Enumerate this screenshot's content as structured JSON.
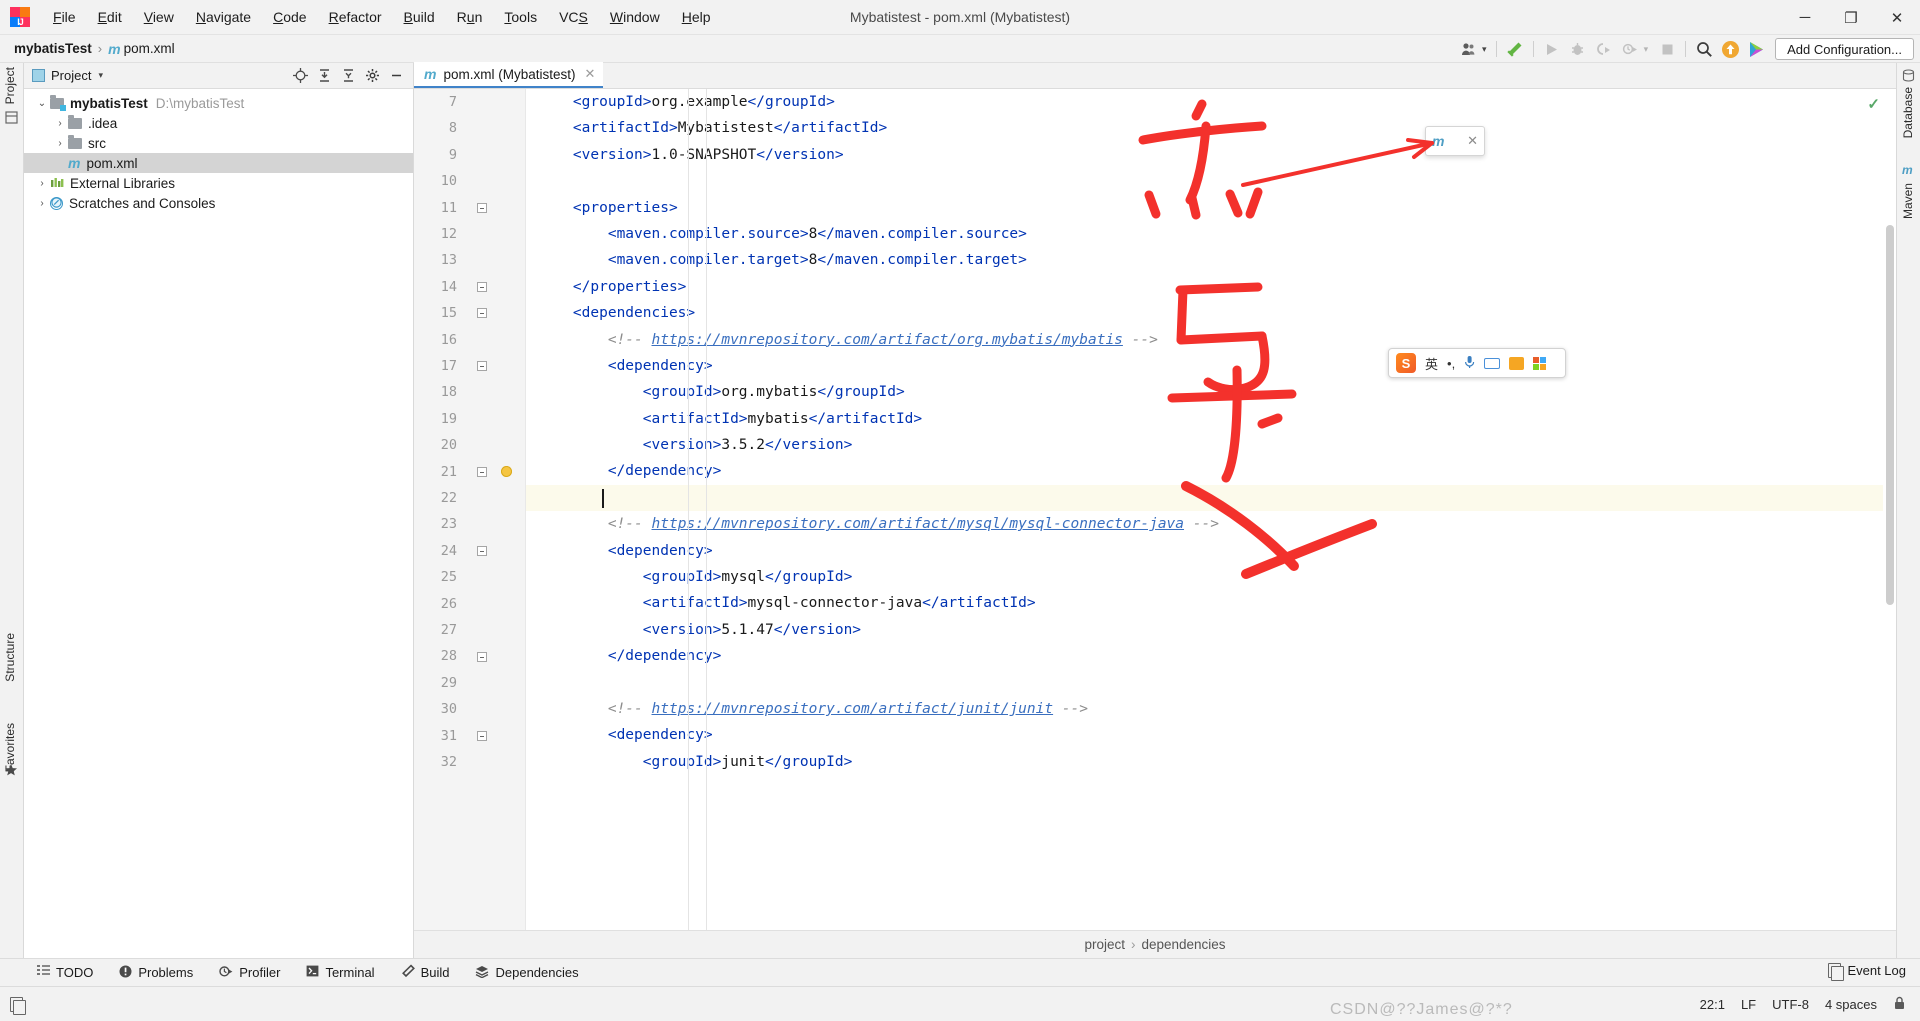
{
  "titlebar": {
    "app_icon": "intellij-logo-icon",
    "window_title": "Mybatistest - pom.xml (Mybatistest)",
    "menus": [
      {
        "label": "File"
      },
      {
        "label": "Edit"
      },
      {
        "label": "View"
      },
      {
        "label": "Navigate"
      },
      {
        "label": "Code"
      },
      {
        "label": "Refactor"
      },
      {
        "label": "Build"
      },
      {
        "label": "Run"
      },
      {
        "label": "Tools"
      },
      {
        "label": "VCS"
      },
      {
        "label": "Window"
      },
      {
        "label": "Help"
      }
    ],
    "controls": {
      "minimize": "─",
      "maximize": "❐",
      "close": "✕"
    }
  },
  "navbar": {
    "breadcrumb": {
      "project": "mybatisTest",
      "separator": "›",
      "file": "pom.xml",
      "file_icon_glyph": "m"
    },
    "add_configuration": "Add Configuration...",
    "icons": [
      "user-settings-icon",
      "build-hammer-icon",
      "run-icon",
      "debug-icon",
      "run-with-coverage-icon",
      "profile-icon",
      "stop-icon",
      "search-icon",
      "updates-icon",
      "ide-features-icon"
    ]
  },
  "left_strip": {
    "top_label": "Project",
    "bottom_labels": [
      "Structure",
      "Favorites"
    ],
    "bookmark_icon": "star-icon"
  },
  "right_strip": {
    "labels": [
      "Database",
      "Maven"
    ]
  },
  "project_panel": {
    "title": "Project",
    "dropdown_glyph": "▾",
    "actions": [
      "locate-icon",
      "expand-all-icon",
      "collapse-all-icon",
      "settings-gear-icon",
      "hide-icon"
    ],
    "tree": [
      {
        "label": "mybatisTest",
        "path": "D:\\mybatisTest",
        "icon": "module-folder-icon",
        "arrow": "⌄",
        "depth": 0,
        "bold": true,
        "selected": false
      },
      {
        "label": ".idea",
        "path": "",
        "icon": "folder-icon",
        "arrow": "›",
        "depth": 1,
        "bold": false,
        "selected": false
      },
      {
        "label": "src",
        "path": "",
        "icon": "folder-icon",
        "arrow": "›",
        "depth": 1,
        "bold": false,
        "selected": false
      },
      {
        "label": "pom.xml",
        "path": "",
        "icon": "maven-file-icon",
        "arrow": "",
        "depth": 1,
        "bold": false,
        "selected": true
      },
      {
        "label": "External Libraries",
        "path": "",
        "icon": "libraries-icon",
        "arrow": "›",
        "depth": 0,
        "bold": false,
        "selected": false
      },
      {
        "label": "Scratches and Consoles",
        "path": "",
        "icon": "scratches-icon",
        "arrow": "›",
        "depth": 0,
        "bold": false,
        "selected": false
      }
    ]
  },
  "editor": {
    "tab": {
      "label": "pom.xml (Mybatistest)",
      "icon_glyph": "m",
      "close_glyph": "✕"
    },
    "inspection_status": "✓",
    "first_line_number": 7,
    "current_line": 22,
    "lines": [
      {
        "n": 7,
        "indent": 2,
        "fold": "",
        "bulb": false,
        "segments": [
          {
            "t": "tag",
            "v": "<groupId>"
          },
          {
            "t": "text",
            "v": "org.example"
          },
          {
            "t": "tag",
            "v": "</groupId>"
          }
        ]
      },
      {
        "n": 8,
        "indent": 2,
        "fold": "",
        "bulb": false,
        "segments": [
          {
            "t": "tag",
            "v": "<artifactId>"
          },
          {
            "t": "text",
            "v": "Mybatistest"
          },
          {
            "t": "tag",
            "v": "</artifactId>"
          }
        ]
      },
      {
        "n": 9,
        "indent": 2,
        "fold": "",
        "bulb": false,
        "segments": [
          {
            "t": "tag",
            "v": "<version>"
          },
          {
            "t": "text",
            "v": "1.0-SNAPSHOT"
          },
          {
            "t": "tag",
            "v": "</version>"
          }
        ]
      },
      {
        "n": 10,
        "indent": 0,
        "fold": "",
        "bulb": false,
        "segments": []
      },
      {
        "n": 11,
        "indent": 2,
        "fold": "start",
        "bulb": false,
        "segments": [
          {
            "t": "tag",
            "v": "<properties>"
          }
        ]
      },
      {
        "n": 12,
        "indent": 4,
        "fold": "",
        "bulb": false,
        "segments": [
          {
            "t": "tag",
            "v": "<maven.compiler.source>"
          },
          {
            "t": "text",
            "v": "8"
          },
          {
            "t": "tag",
            "v": "</maven.compiler.source>"
          }
        ]
      },
      {
        "n": 13,
        "indent": 4,
        "fold": "",
        "bulb": false,
        "segments": [
          {
            "t": "tag",
            "v": "<maven.compiler.target>"
          },
          {
            "t": "text",
            "v": "8"
          },
          {
            "t": "tag",
            "v": "</maven.compiler.target>"
          }
        ]
      },
      {
        "n": 14,
        "indent": 2,
        "fold": "end",
        "bulb": false,
        "segments": [
          {
            "t": "tag",
            "v": "</properties>"
          }
        ]
      },
      {
        "n": 15,
        "indent": 2,
        "fold": "start",
        "bulb": false,
        "segments": [
          {
            "t": "tag",
            "v": "<dependencies>"
          }
        ]
      },
      {
        "n": 16,
        "indent": 4,
        "fold": "",
        "bulb": false,
        "segments": [
          {
            "t": "com",
            "v": "<!-- "
          },
          {
            "t": "link",
            "v": "https://mvnrepository.com/artifact/org.mybatis/mybatis"
          },
          {
            "t": "com",
            "v": " -->"
          }
        ]
      },
      {
        "n": 17,
        "indent": 4,
        "fold": "start",
        "bulb": false,
        "segments": [
          {
            "t": "tag",
            "v": "<dependency>"
          }
        ]
      },
      {
        "n": 18,
        "indent": 6,
        "fold": "",
        "bulb": false,
        "segments": [
          {
            "t": "tag",
            "v": "<groupId>"
          },
          {
            "t": "text",
            "v": "org.mybatis"
          },
          {
            "t": "tag",
            "v": "</groupId>"
          }
        ]
      },
      {
        "n": 19,
        "indent": 6,
        "fold": "",
        "bulb": false,
        "segments": [
          {
            "t": "tag",
            "v": "<artifactId>"
          },
          {
            "t": "text",
            "v": "mybatis"
          },
          {
            "t": "tag",
            "v": "</artifactId>"
          }
        ]
      },
      {
        "n": 20,
        "indent": 6,
        "fold": "",
        "bulb": false,
        "segments": [
          {
            "t": "tag",
            "v": "<version>"
          },
          {
            "t": "text",
            "v": "3.5.2"
          },
          {
            "t": "tag",
            "v": "</version>"
          }
        ]
      },
      {
        "n": 21,
        "indent": 4,
        "fold": "end",
        "bulb": true,
        "segments": [
          {
            "t": "tag",
            "v": "</dependency>"
          }
        ]
      },
      {
        "n": 22,
        "indent": 0,
        "fold": "",
        "bulb": false,
        "segments": []
      },
      {
        "n": 23,
        "indent": 4,
        "fold": "",
        "bulb": false,
        "segments": [
          {
            "t": "com",
            "v": "<!-- "
          },
          {
            "t": "link",
            "v": "https://mvnrepository.com/artifact/mysql/mysql-connector-java"
          },
          {
            "t": "com",
            "v": " -->"
          }
        ]
      },
      {
        "n": 24,
        "indent": 4,
        "fold": "start",
        "bulb": false,
        "segments": [
          {
            "t": "tag",
            "v": "<dependency>"
          }
        ]
      },
      {
        "n": 25,
        "indent": 6,
        "fold": "",
        "bulb": false,
        "segments": [
          {
            "t": "tag",
            "v": "<groupId>"
          },
          {
            "t": "text",
            "v": "mysql"
          },
          {
            "t": "tag",
            "v": "</groupId>"
          }
        ]
      },
      {
        "n": 26,
        "indent": 6,
        "fold": "",
        "bulb": false,
        "segments": [
          {
            "t": "tag",
            "v": "<artifactId>"
          },
          {
            "t": "text",
            "v": "mysql-connector-java"
          },
          {
            "t": "tag",
            "v": "</artifactId>"
          }
        ]
      },
      {
        "n": 27,
        "indent": 6,
        "fold": "",
        "bulb": false,
        "segments": [
          {
            "t": "tag",
            "v": "<version>"
          },
          {
            "t": "text",
            "v": "5.1.47"
          },
          {
            "t": "tag",
            "v": "</version>"
          }
        ]
      },
      {
        "n": 28,
        "indent": 4,
        "fold": "end",
        "bulb": false,
        "segments": [
          {
            "t": "tag",
            "v": "</dependency>"
          }
        ]
      },
      {
        "n": 29,
        "indent": 0,
        "fold": "",
        "bulb": false,
        "segments": []
      },
      {
        "n": 30,
        "indent": 4,
        "fold": "",
        "bulb": false,
        "segments": [
          {
            "t": "com",
            "v": "<!-- "
          },
          {
            "t": "link",
            "v": "https://mvnrepository.com/artifact/junit/junit"
          },
          {
            "t": "com",
            "v": " -->"
          }
        ]
      },
      {
        "n": 31,
        "indent": 4,
        "fold": "start",
        "bulb": false,
        "segments": [
          {
            "t": "tag",
            "v": "<dependency>"
          }
        ]
      },
      {
        "n": 32,
        "indent": 6,
        "fold": "",
        "bulb": false,
        "segments": [
          {
            "t": "tag",
            "v": "<groupId>"
          },
          {
            "t": "text",
            "v": "junit"
          },
          {
            "t": "tag",
            "v": "</groupId>"
          }
        ]
      }
    ],
    "breadcrumb": {
      "first": "project",
      "separator": "›",
      "second": "dependencies"
    }
  },
  "maven_popup": {
    "icon_glyph": "m",
    "refresh_glyph": "↻",
    "close_glyph": "✕"
  },
  "ime_toolbar": {
    "logo_text": "S",
    "mode_label": "英",
    "dots": "•,",
    "icons": [
      "microphone-icon",
      "keyboard-icon",
      "toolbox-icon",
      "apps-grid-icon"
    ]
  },
  "bottom_bar": {
    "items": [
      {
        "label": "TODO",
        "icon": "todo-list-icon"
      },
      {
        "label": "Problems",
        "icon": "problems-icon"
      },
      {
        "label": "Profiler",
        "icon": "profiler-icon"
      },
      {
        "label": "Terminal",
        "icon": "terminal-icon"
      },
      {
        "label": "Build",
        "icon": "build-hammer-icon"
      },
      {
        "label": "Dependencies",
        "icon": "dependencies-layers-icon"
      }
    ]
  },
  "status_bar": {
    "event_log": "Event Log",
    "event_log_icon": "event-log-icon",
    "caret_position": "22:1",
    "line_separator": "LF",
    "encoding": "UTF-8",
    "indent": "4 spaces",
    "lock_icon": "lock-icon",
    "watermark": "CSDN@??James@?*?"
  },
  "annotations": {
    "char1": "点",
    "char2": "已",
    "char3": "寸",
    "char4": "入",
    "arrow_color": "#f3312c",
    "note": "hand-drawn red annotations"
  }
}
